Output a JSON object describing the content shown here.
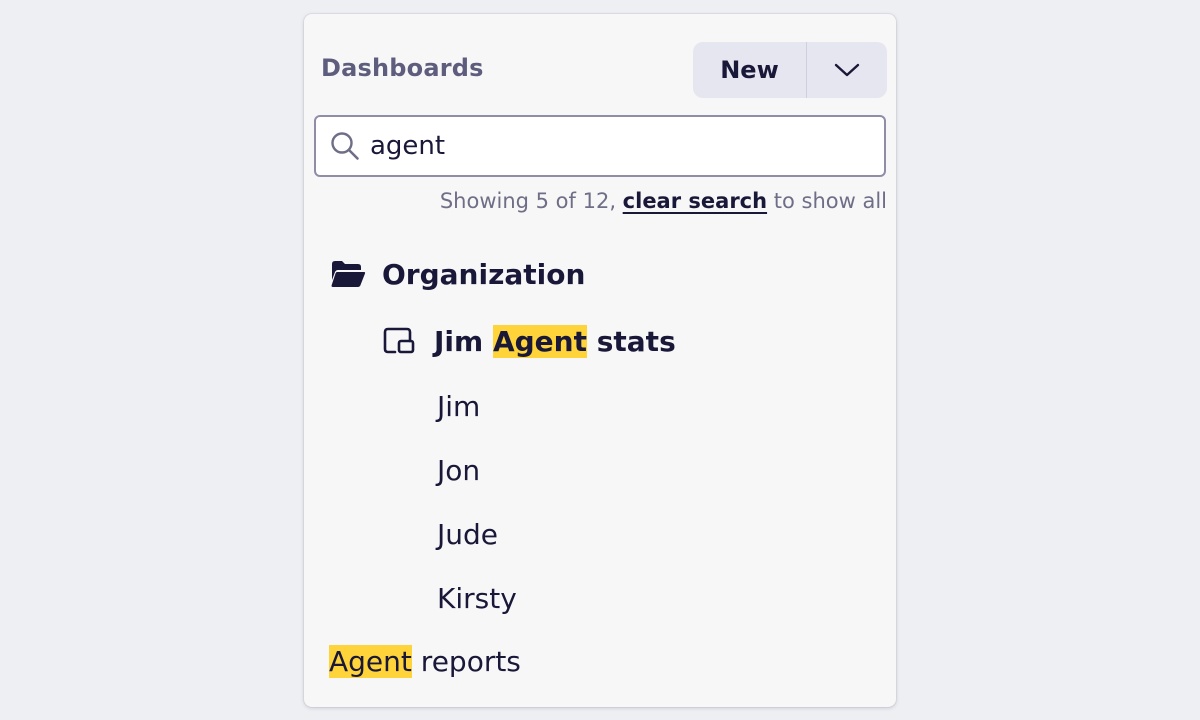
{
  "header": {
    "title": "Dashboards",
    "new_label": "New"
  },
  "search": {
    "value": "agent"
  },
  "results": {
    "prefix": "Showing 5 of 12, ",
    "clear_link": "clear search",
    "suffix": " to show all"
  },
  "tree": {
    "folder": {
      "label": "Organization",
      "icon": "folder-open-icon"
    },
    "dashboard": {
      "label_before": "Jim ",
      "label_highlight": "Agent",
      "label_after": " stats",
      "icon": "dashboard-icon",
      "children": [
        "Jim",
        "Jon",
        "Jude",
        "Kirsty"
      ]
    },
    "top_item": {
      "label_highlight": "Agent",
      "label_after": " reports"
    }
  },
  "colors": {
    "highlight": "#ffd43b",
    "text": "#1a1838",
    "muted": "#6f6e87",
    "title": "#5e5d7d"
  }
}
